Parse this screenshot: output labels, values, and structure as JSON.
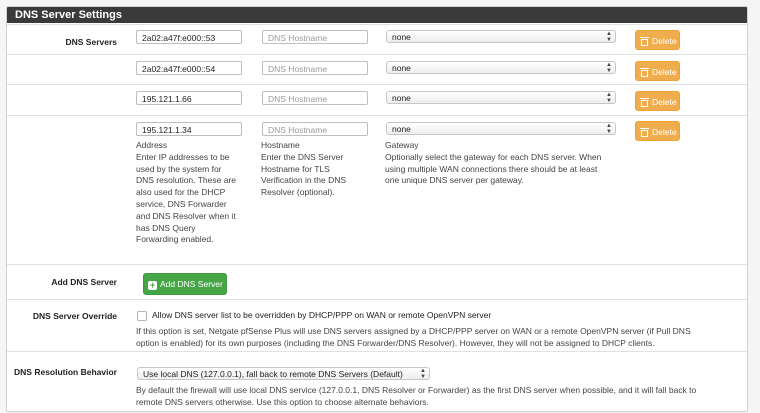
{
  "panel": {
    "title": "DNS Server Settings"
  },
  "dns_servers": {
    "label": "DNS Servers",
    "rows": [
      {
        "address": "2a02:a47f:e000::53",
        "hostname_placeholder": "DNS Hostname",
        "gateway": "none",
        "delete_label": "Delete"
      },
      {
        "address": "2a02:a47f:e000::54",
        "hostname_placeholder": "DNS Hostname",
        "gateway": "none",
        "delete_label": "Delete"
      },
      {
        "address": "195.121.1.66",
        "hostname_placeholder": "DNS Hostname",
        "gateway": "none",
        "delete_label": "Delete"
      },
      {
        "address": "195.121.1.34",
        "hostname_placeholder": "DNS Hostname",
        "gateway": "none",
        "delete_label": "Delete"
      }
    ],
    "help_address": [
      "Address",
      "Enter IP addresses to be",
      "used by the system for",
      "DNS resolution. These are",
      "also used for the DHCP",
      "service, DNS Forwarder",
      "and DNS Resolver when it",
      "has DNS Query",
      "Forwarding enabled."
    ],
    "help_hostname": [
      "Hostname",
      "Enter the DNS Server",
      "Hostname for TLS",
      "Verification in the DNS",
      "Resolver (optional)."
    ],
    "help_gateway": [
      "Gateway",
      "Optionally select the gateway for each DNS server. When",
      "using multiple WAN connections there should be at least",
      "one unique DNS server per gateway."
    ]
  },
  "add_dns_server": {
    "label": "Add DNS Server",
    "button_label": "Add DNS Server"
  },
  "override": {
    "label": "DNS Server Override",
    "checkbox_label": "Allow DNS server list to be overridden by DHCP/PPP on WAN or remote OpenVPN server",
    "checked": false,
    "help": [
      "If this option is set, Netgate pfSense Plus will use DNS servers assigned by a DHCP/PPP server on WAN or a remote OpenVPN server (if Pull DNS",
      "option is enabled) for its own purposes (including the DNS Forwarder/DNS Resolver). However, they will not be assigned to DHCP clients."
    ]
  },
  "resolution": {
    "label": "DNS Resolution Behavior",
    "selected": "Use local DNS (127.0.0.1), fall back to remote DNS Servers (Default)",
    "help": [
      "By default the firewall will use local DNS service (127.0.0.1, DNS Resolver or Forwarder) as the first DNS server when possible, and it will fall back to",
      "remote DNS servers otherwise. Use this option to choose alternate behaviors."
    ]
  },
  "colors": {
    "heading_bg": "#3a3a3a",
    "delete_button": "#f0ad4e",
    "add_button": "#46a546"
  },
  "icons": {
    "delete": "trash-icon",
    "add": "plus-icon",
    "select_arrow": "updown-arrow-icon"
  }
}
